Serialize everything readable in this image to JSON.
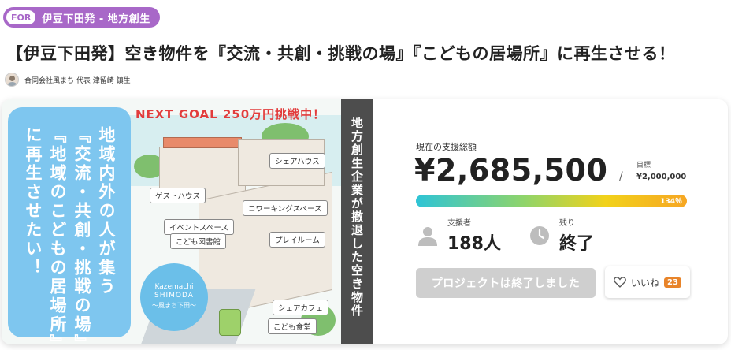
{
  "tag": {
    "for_label": "FOR",
    "text": "伊豆下田発 - 地方創生"
  },
  "title": "【伊豆下田発】空き物件を『交流・共創・挑戦の場』『こどもの居場所』に再生させる！",
  "author": {
    "name": "合同会社風まち 代表 津留崎 鎮生"
  },
  "visual": {
    "goal_banner": "NEXT GOAL 250万円挑戦中！",
    "bubble_columns": [
      "地域内外の人が集う",
      "『交流・共創・挑戦の場』",
      "『地域のこどもの居場所』",
      "に再生させたい！"
    ],
    "side_text": "地方創生企業が撤退した空き物件",
    "stickers": [
      "シェアハウス",
      "ゲストハウス",
      "コワーキングスペース",
      "イベントスペース",
      "こども図書館",
      "プレイルーム",
      "シェアカフェ",
      "こども食堂"
    ],
    "logo": {
      "line1": "Kazemachi",
      "line2": "SHIMODA",
      "line3": "〜風まち下田〜"
    }
  },
  "funding": {
    "total_label": "現在の支援総額",
    "total_amount": "¥2,685,500",
    "slash": "/",
    "goal_label": "目標",
    "goal_amount": "¥2,000,000",
    "progress_percent_label": "134％",
    "progress_fraction": 1.0
  },
  "stats": {
    "supporters_label": "支援者",
    "supporters_value": "188人",
    "remaining_label": "残り",
    "remaining_value": "終了"
  },
  "actions": {
    "ended_button": "プロジェクトは終了しました",
    "like_label": "いいね",
    "like_count": "23"
  },
  "colors": {
    "tag_purple": "#a868c8",
    "bubble_blue": "#7ec6ef",
    "goal_red": "#e23c3c",
    "like_orange": "#e8842a",
    "ended_gray": "#cfcfcf"
  }
}
